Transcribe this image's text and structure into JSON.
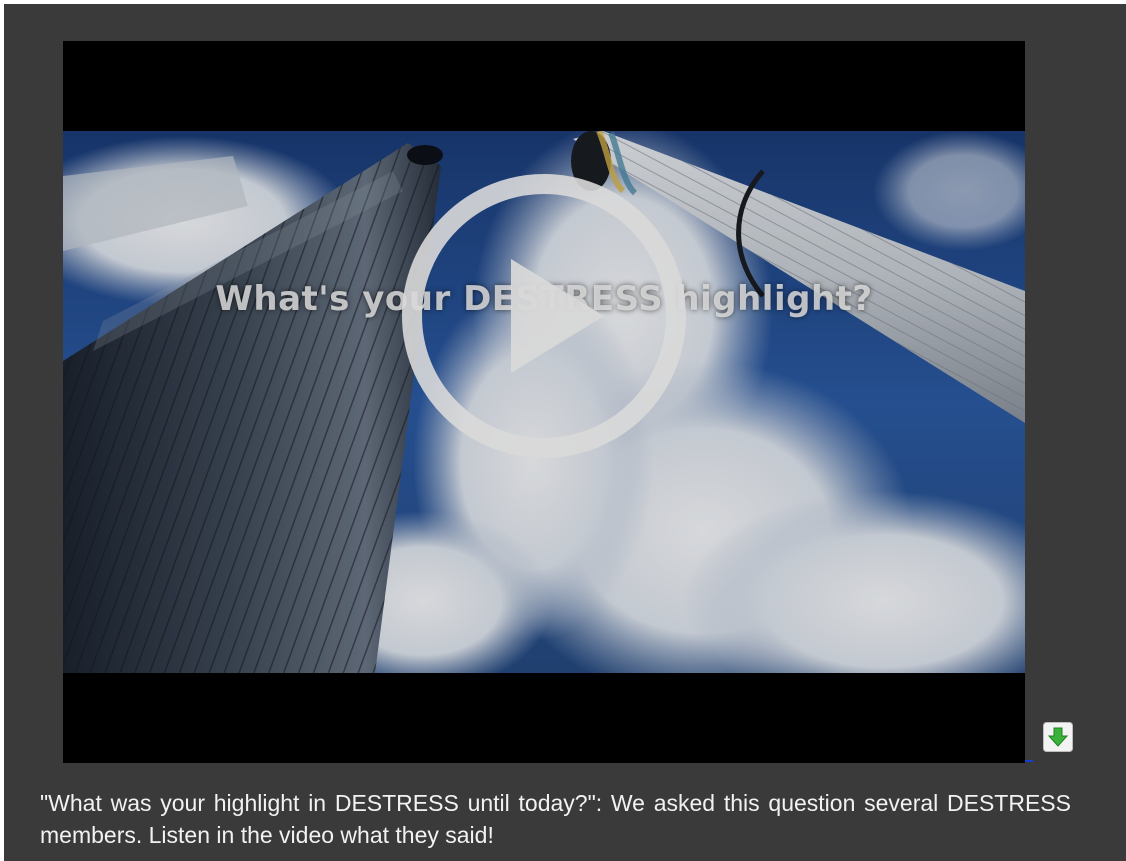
{
  "video": {
    "overlay_text": "What's your DESTRESS highlight?",
    "play_icon": "play-circle-icon"
  },
  "download": {
    "icon": "download-arrow-icon"
  },
  "description": "\"What was your highlight in DESTRESS until today?\": We asked this question several DESTRESS members. Listen in the video what they said!",
  "colors": {
    "panel_background": "#3a3a3a",
    "letterbox": "#000000",
    "description_text": "#f2f2f2",
    "download_arrow": "#3bb33b"
  }
}
